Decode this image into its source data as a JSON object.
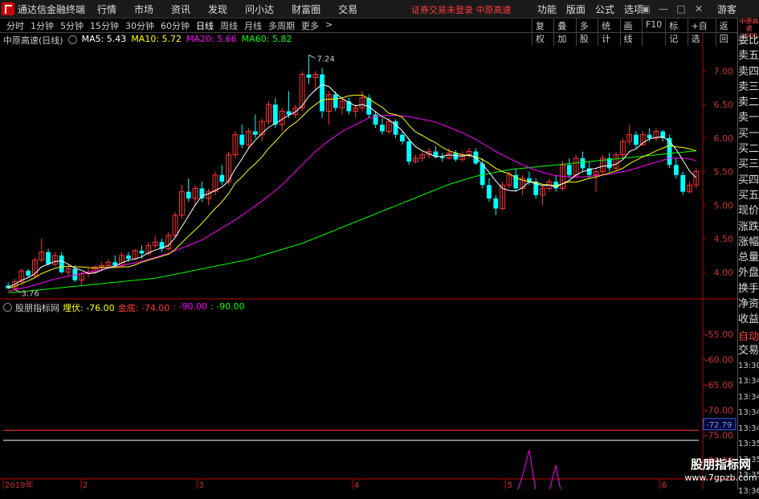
{
  "window": {
    "title": "通达信金融终端",
    "menu": [
      "行情",
      "市场",
      "资讯",
      "发现",
      "问小达",
      "财富圈",
      "交易"
    ],
    "warning": "证券交易未登录  中原高速",
    "right_menu": [
      "功能",
      "版面",
      "公式",
      "选项"
    ],
    "guest": "游客"
  },
  "toolbar": {
    "periods": [
      "分时",
      "1分钟",
      "5分钟",
      "15分钟",
      "30分钟",
      "60分钟",
      "日线",
      "周线",
      "月线",
      "多周期",
      "更多"
    ],
    "active_period": "日线",
    "tools": [
      "复权",
      "叠加",
      "多股",
      "统计",
      "画线",
      "F10",
      "标记",
      "+自选",
      "返回"
    ]
  },
  "main_legend": {
    "title": "中原高速(日线)",
    "ma5": "MA5: 5.43",
    "ma10": "MA10: 5.72",
    "ma20": "MA20: 5.66",
    "ma60": "MA60: 5.82",
    "colors": {
      "ma5": "#ffffff",
      "ma10": "#ffff00",
      "ma20": "#ff00ff",
      "ma60": "#00ff00"
    }
  },
  "indicator_legend": {
    "name": "股朋指标网",
    "label1": "埋伏: -76.00",
    "label2": "金底: -74.00",
    "label3": ": -90.00",
    "label4": ": -90.00"
  },
  "price_axis": [
    "7.00",
    "6.50",
    "6.00",
    "5.50",
    "5.00",
    "4.50",
    "4.00"
  ],
  "price_range": [
    3.65,
    7.4
  ],
  "high_label": "7.24",
  "low_label": "3.76",
  "ind_axis": [
    "-55.00",
    "-60.00",
    "-65.00",
    "-70.00",
    "-75.00",
    "-80.00"
  ],
  "ind_range": [
    -83.5,
    -50.5
  ],
  "ind_cursor": "-72.79",
  "x_axis": [
    "2019年",
    "2",
    "3",
    "4",
    "5",
    "6"
  ],
  "right_panel": {
    "header": "中原高速 1000",
    "items": [
      "委比",
      "卖五",
      "卖四",
      "卖三",
      "卖二",
      "卖一",
      "买一",
      "买二",
      "买三",
      "买四",
      "买五",
      "现价",
      "涨跌",
      "涨幅",
      "总量",
      "外盘",
      "换手",
      "净资",
      "收益"
    ],
    "auto": "自动",
    "trade": "交易",
    "times": [
      "13:30",
      "13:34",
      "13:34",
      "13:34",
      "13:34",
      "13:35",
      "13:35",
      "13:35",
      "13:36"
    ]
  },
  "watermark": {
    "line1": "股朋指标网",
    "line2": "www.7gpzb.com"
  },
  "chart_data": {
    "type": "candlestick",
    "title": "中原高速(日线)",
    "candles": [
      [
        3.8,
        3.85,
        3.75,
        3.76
      ],
      [
        3.76,
        3.9,
        3.74,
        3.86
      ],
      [
        3.86,
        4.05,
        3.84,
        4.02
      ],
      [
        4.02,
        4.05,
        3.92,
        3.95
      ],
      [
        3.95,
        4.22,
        3.92,
        4.18
      ],
      [
        4.18,
        4.5,
        4.15,
        4.3
      ],
      [
        4.3,
        4.35,
        4.1,
        4.12
      ],
      [
        4.12,
        4.3,
        4.08,
        4.25
      ],
      [
        4.25,
        4.3,
        3.98,
        4.0
      ],
      [
        4.0,
        4.08,
        3.95,
        4.05
      ],
      [
        4.05,
        4.1,
        3.85,
        3.88
      ],
      [
        3.88,
        4.0,
        3.8,
        3.98
      ],
      [
        3.98,
        4.08,
        3.92,
        4.0
      ],
      [
        4.0,
        4.1,
        3.98,
        4.08
      ],
      [
        4.08,
        4.15,
        4.02,
        4.1
      ],
      [
        4.1,
        4.2,
        4.05,
        4.15
      ],
      [
        4.15,
        4.25,
        4.08,
        4.1
      ],
      [
        4.1,
        4.3,
        4.08,
        4.25
      ],
      [
        4.25,
        4.3,
        4.15,
        4.2
      ],
      [
        4.2,
        4.35,
        4.18,
        4.32
      ],
      [
        4.32,
        4.4,
        4.2,
        4.28
      ],
      [
        4.28,
        4.45,
        4.25,
        4.4
      ],
      [
        4.4,
        4.55,
        4.35,
        4.45
      ],
      [
        4.45,
        4.5,
        4.3,
        4.35
      ],
      [
        4.35,
        4.6,
        4.32,
        4.55
      ],
      [
        4.55,
        4.9,
        4.52,
        4.85
      ],
      [
        4.85,
        5.3,
        4.8,
        5.2
      ],
      [
        5.2,
        5.4,
        5.05,
        5.1
      ],
      [
        5.1,
        5.3,
        5.0,
        5.25
      ],
      [
        5.25,
        5.35,
        5.05,
        5.1
      ],
      [
        5.1,
        5.25,
        5.0,
        5.2
      ],
      [
        5.2,
        5.5,
        5.15,
        5.45
      ],
      [
        5.45,
        5.6,
        5.3,
        5.35
      ],
      [
        5.35,
        5.8,
        5.3,
        5.75
      ],
      [
        5.75,
        6.1,
        5.7,
        6.05
      ],
      [
        6.05,
        6.2,
        5.85,
        5.9
      ],
      [
        5.9,
        6.15,
        5.85,
        6.1
      ],
      [
        6.1,
        6.35,
        6.0,
        6.05
      ],
      [
        6.05,
        6.3,
        5.95,
        6.25
      ],
      [
        6.25,
        6.55,
        6.2,
        6.5
      ],
      [
        6.5,
        6.6,
        6.15,
        6.2
      ],
      [
        6.2,
        6.45,
        6.1,
        6.4
      ],
      [
        6.4,
        6.7,
        6.3,
        6.35
      ],
      [
        6.35,
        6.5,
        6.3,
        6.45
      ],
      [
        6.45,
        7.0,
        6.4,
        6.95
      ],
      [
        6.95,
        7.24,
        6.8,
        6.9
      ],
      [
        6.9,
        7.0,
        6.7,
        6.95
      ],
      [
        6.95,
        7.05,
        6.3,
        6.4
      ],
      [
        6.4,
        6.7,
        6.2,
        6.65
      ],
      [
        6.65,
        6.7,
        6.4,
        6.45
      ],
      [
        6.45,
        6.6,
        6.35,
        6.55
      ],
      [
        6.55,
        6.6,
        6.35,
        6.4
      ],
      [
        6.4,
        6.5,
        6.3,
        6.45
      ],
      [
        6.45,
        6.7,
        6.4,
        6.6
      ],
      [
        6.6,
        6.65,
        6.3,
        6.35
      ],
      [
        6.35,
        6.4,
        6.15,
        6.2
      ],
      [
        6.2,
        6.3,
        6.05,
        6.1
      ],
      [
        6.1,
        6.3,
        6.05,
        6.25
      ],
      [
        6.25,
        6.28,
        6.0,
        6.05
      ],
      [
        6.05,
        6.1,
        5.9,
        5.95
      ],
      [
        5.95,
        6.0,
        5.6,
        5.65
      ],
      [
        5.65,
        5.75,
        5.62,
        5.7
      ],
      [
        5.7,
        5.8,
        5.65,
        5.75
      ],
      [
        5.75,
        5.85,
        5.7,
        5.8
      ],
      [
        5.8,
        5.88,
        5.7,
        5.72
      ],
      [
        5.72,
        5.78,
        5.65,
        5.7
      ],
      [
        5.7,
        5.85,
        5.68,
        5.78
      ],
      [
        5.78,
        5.82,
        5.65,
        5.68
      ],
      [
        5.68,
        5.8,
        5.65,
        5.75
      ],
      [
        5.75,
        5.85,
        5.7,
        5.8
      ],
      [
        5.8,
        5.85,
        5.6,
        5.62
      ],
      [
        5.62,
        5.7,
        5.25,
        5.3
      ],
      [
        5.3,
        5.4,
        5.05,
        5.1
      ],
      [
        5.1,
        5.15,
        4.85,
        4.95
      ],
      [
        4.95,
        5.35,
        4.92,
        5.3
      ],
      [
        5.3,
        5.5,
        5.25,
        5.45
      ],
      [
        5.45,
        5.55,
        5.2,
        5.25
      ],
      [
        5.25,
        5.45,
        5.15,
        5.4
      ],
      [
        5.4,
        5.5,
        5.3,
        5.35
      ],
      [
        5.35,
        5.4,
        5.1,
        5.15
      ],
      [
        5.15,
        5.3,
        5.0,
        5.25
      ],
      [
        5.25,
        5.4,
        5.2,
        5.35
      ],
      [
        5.35,
        5.45,
        5.2,
        5.25
      ],
      [
        5.25,
        5.65,
        5.22,
        5.6
      ],
      [
        5.6,
        5.7,
        5.4,
        5.45
      ],
      [
        5.45,
        5.75,
        5.4,
        5.7
      ],
      [
        5.7,
        5.8,
        5.5,
        5.55
      ],
      [
        5.55,
        5.65,
        5.4,
        5.45
      ],
      [
        5.45,
        5.55,
        5.2,
        5.5
      ],
      [
        5.5,
        5.75,
        5.45,
        5.7
      ],
      [
        5.7,
        5.78,
        5.5,
        5.55
      ],
      [
        5.55,
        5.8,
        5.5,
        5.75
      ],
      [
        5.75,
        6.0,
        5.7,
        5.95
      ],
      [
        5.95,
        6.2,
        5.9,
        6.05
      ],
      [
        6.05,
        6.1,
        5.85,
        5.9
      ],
      [
        5.9,
        6.1,
        5.88,
        6.05
      ],
      [
        6.05,
        6.15,
        5.95,
        6.0
      ],
      [
        6.0,
        6.15,
        5.95,
        6.1
      ],
      [
        6.1,
        6.12,
        5.95,
        6.0
      ],
      [
        6.0,
        6.05,
        5.55,
        5.6
      ],
      [
        5.6,
        5.7,
        5.4,
        5.45
      ],
      [
        5.45,
        5.5,
        5.15,
        5.2
      ],
      [
        5.2,
        5.35,
        5.18,
        5.3
      ],
      [
        5.3,
        5.55,
        5.25,
        5.5
      ]
    ],
    "ma": {
      "ma5": [
        3.78,
        3.82,
        3.88,
        3.92,
        3.98,
        4.08,
        4.12,
        4.16,
        4.17,
        4.12,
        4.06,
        4.03,
        3.98,
        3.99,
        4.03,
        4.07,
        4.09,
        4.14,
        4.18,
        4.2,
        4.23,
        4.29,
        4.33,
        4.36,
        4.4,
        4.52,
        4.68,
        4.84,
        5.0,
        5.14,
        5.17,
        5.22,
        5.27,
        5.36,
        5.54,
        5.69,
        5.85,
        5.97,
        6.07,
        6.16,
        6.22,
        6.28,
        6.34,
        6.39,
        6.48,
        6.62,
        6.72,
        6.8,
        6.77,
        6.67,
        6.59,
        6.53,
        6.48,
        6.5,
        6.47,
        6.39,
        6.32,
        6.27,
        6.2,
        6.11,
        5.98,
        5.87,
        5.81,
        5.77,
        5.72,
        5.73,
        5.75,
        5.74,
        5.73,
        5.75,
        5.71,
        5.61,
        5.49,
        5.36,
        5.25,
        5.22,
        5.21,
        5.26,
        5.35,
        5.32,
        5.29,
        5.3,
        5.27,
        5.32,
        5.37,
        5.45,
        5.5,
        5.53,
        5.55,
        5.58,
        5.59,
        5.61,
        5.68,
        5.8,
        5.84,
        5.93,
        5.99,
        6.01,
        6.02,
        5.95,
        5.83,
        5.67,
        5.51,
        5.41
      ],
      "ma10": [
        3.76,
        3.79,
        3.83,
        3.87,
        3.92,
        3.98,
        4.02,
        4.06,
        4.08,
        4.09,
        4.08,
        4.08,
        4.07,
        4.06,
        4.07,
        4.07,
        4.07,
        4.08,
        4.08,
        4.11,
        4.15,
        4.18,
        4.21,
        4.24,
        4.27,
        4.34,
        4.44,
        4.54,
        4.63,
        4.73,
        4.84,
        4.95,
        5.05,
        5.17,
        5.33,
        5.42,
        5.53,
        5.62,
        5.72,
        5.85,
        5.95,
        6.06,
        6.16,
        6.23,
        6.32,
        6.42,
        6.5,
        6.57,
        6.58,
        6.58,
        6.6,
        6.63,
        6.64,
        6.64,
        6.58,
        6.52,
        6.46,
        6.37,
        6.35,
        6.31,
        6.19,
        6.09,
        6.04,
        5.98,
        5.93,
        5.86,
        5.81,
        5.78,
        5.75,
        5.74,
        5.72,
        5.68,
        5.62,
        5.55,
        5.5,
        5.47,
        5.41,
        5.37,
        5.35,
        5.34,
        5.31,
        5.3,
        5.29,
        5.32,
        5.35,
        5.34,
        5.37,
        5.4,
        5.42,
        5.45,
        5.48,
        5.51,
        5.55,
        5.62,
        5.67,
        5.72,
        5.76,
        5.81,
        5.85,
        5.89,
        5.87,
        5.86,
        5.84,
        5.81
      ],
      "ma20": [
        3.72,
        3.74,
        3.76,
        3.78,
        3.81,
        3.84,
        3.87,
        3.9,
        3.92,
        3.94,
        3.96,
        3.98,
        4.0,
        4.02,
        4.04,
        4.06,
        4.08,
        4.1,
        4.12,
        4.14,
        4.16,
        4.19,
        4.22,
        4.25,
        4.28,
        4.32,
        4.36,
        4.4,
        4.44,
        4.48,
        4.54,
        4.6,
        4.66,
        4.72,
        4.78,
        4.85,
        4.92,
        4.99,
        5.06,
        5.14,
        5.22,
        5.3,
        5.4,
        5.5,
        5.6,
        5.7,
        5.8,
        5.88,
        5.96,
        6.03,
        6.1,
        6.15,
        6.2,
        6.25,
        6.3,
        6.32,
        6.33,
        6.34,
        6.34,
        6.33,
        6.32,
        6.3,
        6.28,
        6.26,
        6.24,
        6.2,
        6.16,
        6.12,
        6.08,
        6.03,
        5.98,
        5.92,
        5.86,
        5.8,
        5.75,
        5.7,
        5.65,
        5.6,
        5.56,
        5.52,
        5.49,
        5.46,
        5.44,
        5.43,
        5.42,
        5.42,
        5.42,
        5.43,
        5.44,
        5.45,
        5.46,
        5.48,
        5.5,
        5.52,
        5.55,
        5.58,
        5.61,
        5.64,
        5.67,
        5.7,
        5.7,
        5.7,
        5.69,
        5.66
      ],
      "ma60": [
        3.7,
        3.7,
        3.71,
        3.72,
        3.73,
        3.74,
        3.75,
        3.76,
        3.77,
        3.78,
        3.79,
        3.8,
        3.81,
        3.82,
        3.83,
        3.84,
        3.85,
        3.86,
        3.87,
        3.88,
        3.89,
        3.9,
        3.91,
        3.93,
        3.95,
        3.97,
        3.99,
        4.01,
        4.03,
        4.05,
        4.07,
        4.09,
        4.11,
        4.13,
        4.15,
        4.17,
        4.19,
        4.22,
        4.25,
        4.28,
        4.31,
        4.34,
        4.37,
        4.4,
        4.43,
        4.47,
        4.51,
        4.55,
        4.59,
        4.63,
        4.67,
        4.71,
        4.75,
        4.79,
        4.83,
        4.87,
        4.91,
        4.95,
        4.99,
        5.03,
        5.07,
        5.11,
        5.15,
        5.19,
        5.23,
        5.27,
        5.31,
        5.34,
        5.37,
        5.4,
        5.43,
        5.45,
        5.47,
        5.49,
        5.51,
        5.53,
        5.54,
        5.55,
        5.56,
        5.57,
        5.58,
        5.59,
        5.6,
        5.61,
        5.62,
        5.63,
        5.64,
        5.65,
        5.66,
        5.67,
        5.68,
        5.69,
        5.7,
        5.71,
        5.72,
        5.73,
        5.74,
        5.75,
        5.76,
        5.77,
        5.78,
        5.79,
        5.8,
        5.81
      ]
    },
    "indicator": {
      "line_a": -76.0,
      "line_b": -74.0,
      "spikes": [
        [
          75,
          -90
        ],
        [
          76,
          -87
        ],
        [
          77,
          -83
        ],
        [
          78,
          -78
        ],
        [
          79,
          -86
        ],
        [
          80,
          -90
        ],
        [
          81,
          -86
        ],
        [
          82,
          -81
        ],
        [
          83,
          -88
        ],
        [
          84,
          -90
        ],
        [
          85,
          -89.5
        ],
        [
          86,
          -90
        ]
      ]
    }
  }
}
